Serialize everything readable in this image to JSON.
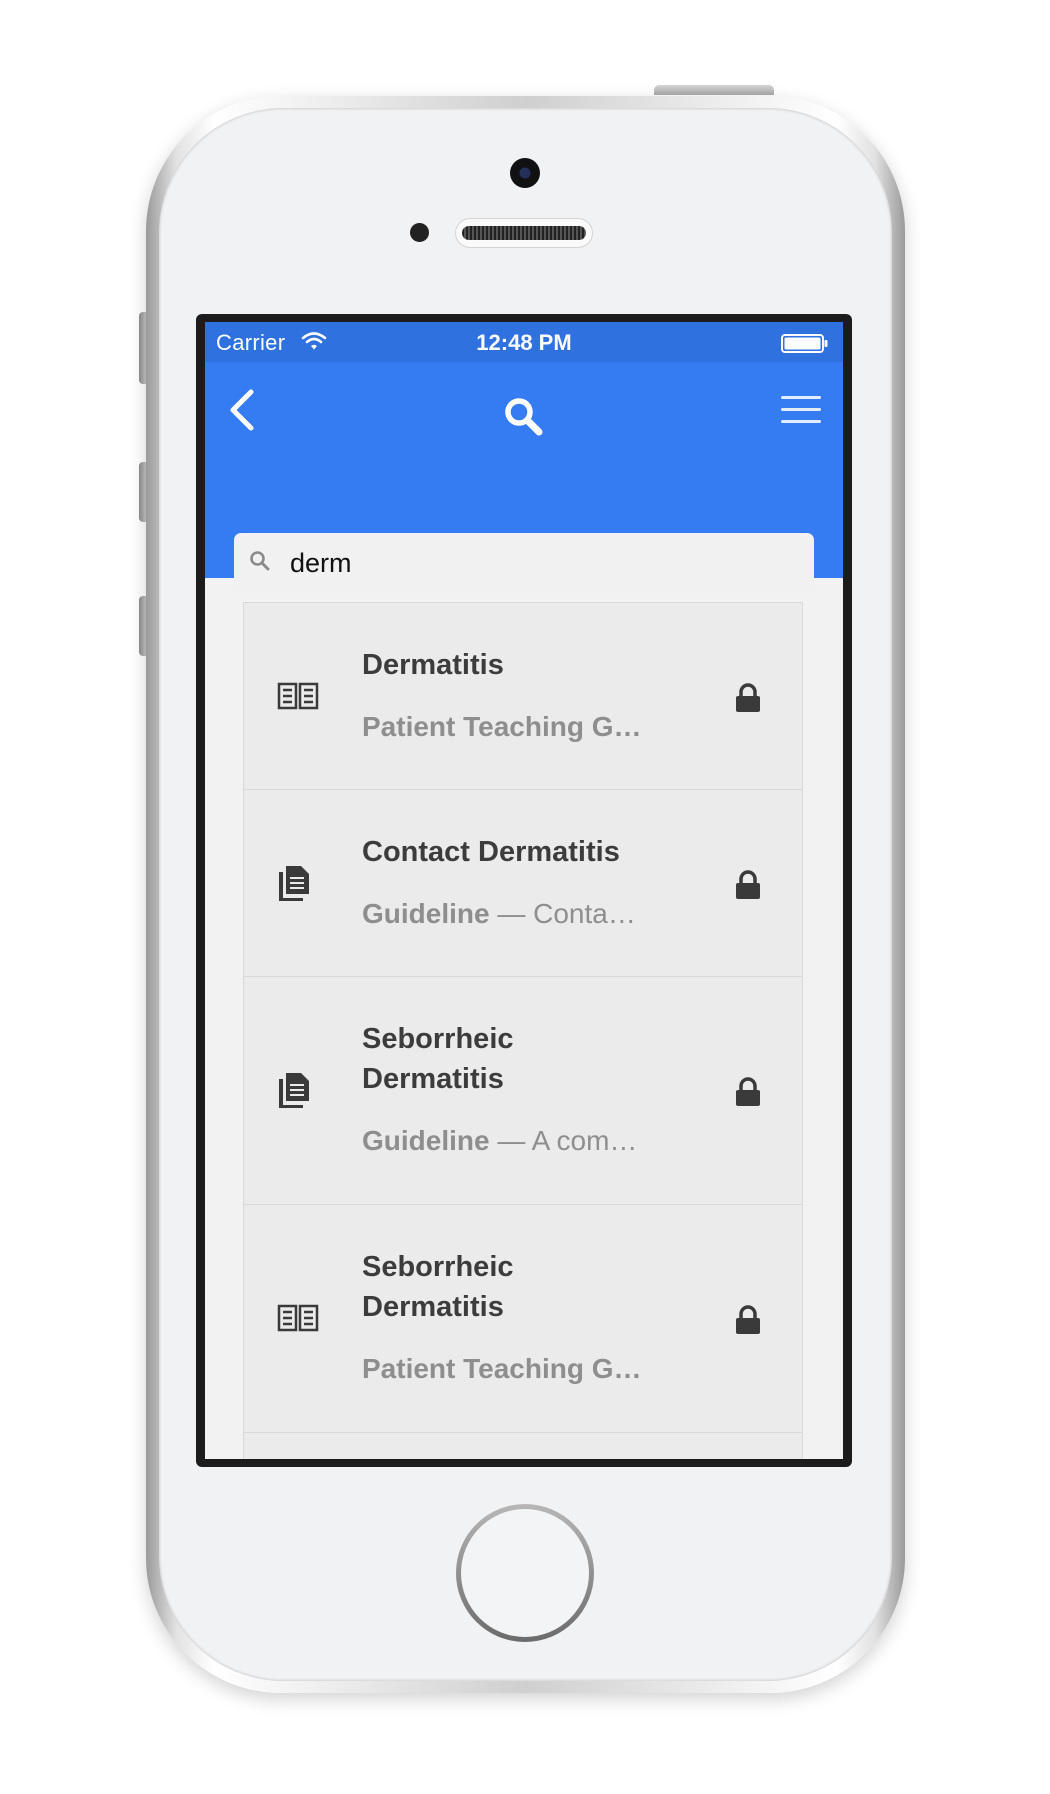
{
  "status_bar": {
    "carrier": "Carrier",
    "time": "12:48 PM"
  },
  "nav": {
    "back_icon": "chevron-left-icon",
    "title_icon": "search-icon",
    "menu_icon": "hamburger-menu-icon"
  },
  "search": {
    "value": "derm"
  },
  "results": [
    {
      "title_line1": "Dermatitis",
      "title_line2": "",
      "kind": "Patient Teaching G…",
      "separator": "",
      "snippet": "",
      "type_icon": "book-icon",
      "locked": true
    },
    {
      "title_line1": "Contact Dermatitis",
      "title_line2": "",
      "kind": "Guideline",
      "separator": " — ",
      "snippet": "Conta…",
      "type_icon": "document-icon",
      "locked": true
    },
    {
      "title_line1": "Seborrheic",
      "title_line2": "Dermatitis",
      "kind": "Guideline",
      "separator": " — ",
      "snippet": "A com…",
      "type_icon": "document-icon",
      "locked": true
    },
    {
      "title_line1": "Seborrheic",
      "title_line2": "Dermatitis",
      "kind": "Patient Teaching G…",
      "separator": "",
      "snippet": "",
      "type_icon": "book-icon",
      "locked": true
    }
  ],
  "colors": {
    "status_bar": "#2f71df",
    "nav_bar": "#357cf3",
    "row_bg": "#ebebeb",
    "title_text": "#3c3c3c",
    "subtitle_text": "#8e8e8e"
  }
}
